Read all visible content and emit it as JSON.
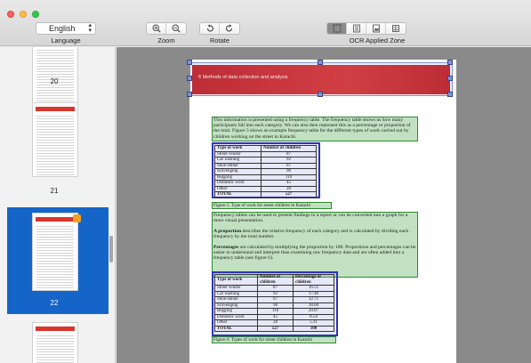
{
  "toolbar": {
    "language_value": "English",
    "language_label": "Language",
    "zoom_label": "Zoom",
    "rotate_label": "Rotate",
    "ocr_zone_label": "OCR Applied Zone"
  },
  "sidebar": {
    "pages": [
      {
        "label": "20"
      },
      {
        "label": "21"
      },
      {
        "label": "22",
        "selected": true
      }
    ]
  },
  "document": {
    "header_title": "6 Methods of data collection and analysis",
    "para1": "This information is presented using a frequency table. The frequency table shows us how many participants fall into each category. We can also then represent this as a percentage or proportion of the total. Figure 5 shows an example frequency table for the different types of work carried out by children working on the street in Karachi.",
    "table1": {
      "headers": [
        "Type of work",
        "Number of children"
      ],
      "rows": [
        [
          "Street vendor",
          "87"
        ],
        [
          "Car washing",
          "92"
        ],
        [
          "Shoe-shiner",
          "67"
        ],
        [
          "Scavenging",
          "98"
        ],
        [
          "Begging",
          "110"
        ],
        [
          "Domestic work",
          "45"
        ],
        [
          "Other",
          "28"
        ],
        [
          "TOTAL",
          "527"
        ]
      ]
    },
    "caption1": "Figure 5. Type of work for street children in Karachi",
    "para2": "Frequency tables can be used to present findings in a report or can be converted into a graph for a more visual presentation.",
    "para3_bold": "A proportion",
    "para3_rest": " describes the relative frequency of each category and is calculated by dividing each frequency by the total number.",
    "para4_bold": "Percentages",
    "para4_rest": " are calculated by multiplying the proportion by 100. Proportions and percentages can be easier to understand and interpret than examining raw frequency data and are often added into a frequency table (see figure 6).",
    "table2": {
      "headers": [
        "Type of work",
        "Number of children",
        "Percentage of children"
      ],
      "rows": [
        [
          "Street vendor",
          "87",
          "16.51"
        ],
        [
          "Car washing",
          "92",
          "17.46"
        ],
        [
          "Shoe-shiner",
          "67",
          "12.71"
        ],
        [
          "Scavenging",
          "98",
          "18.60"
        ],
        [
          "Begging",
          "110",
          "20.87"
        ],
        [
          "Domestic work",
          "45",
          "8.54"
        ],
        [
          "Other",
          "28",
          "5.31"
        ],
        [
          "TOTAL",
          "527",
          "100"
        ]
      ]
    },
    "caption2": "Figure 6. Types of work for street children in Karachi"
  },
  "colors": {
    "selection": "#1565c8",
    "header_red": "#e0322b",
    "ocr_green": "#2d8a2d",
    "ocr_blue": "#2e35b8"
  },
  "icons": [
    "zoom-in-icon",
    "zoom-out-icon",
    "rotate-left-icon",
    "rotate-right-icon",
    "zone-select-icon",
    "zone-text-icon",
    "zone-image-icon",
    "zone-table-icon"
  ]
}
